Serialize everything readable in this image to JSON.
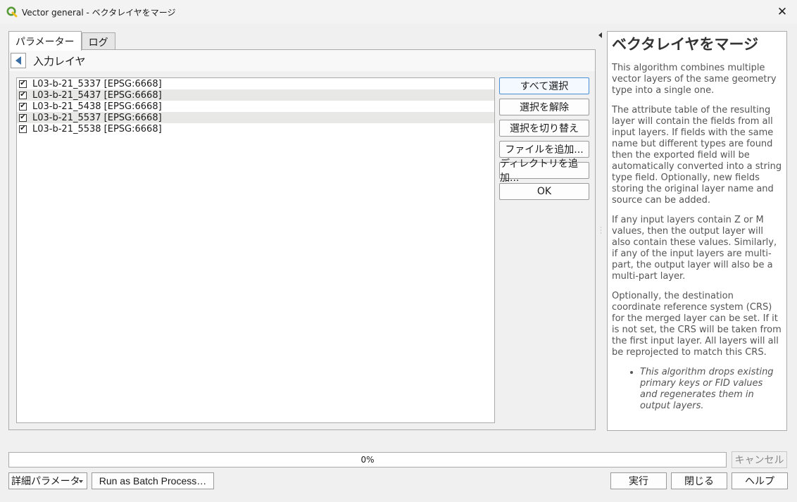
{
  "window": {
    "title": "Vector general - ベクタレイヤをマージ"
  },
  "tabs": [
    {
      "label": "パラメーター",
      "active": true
    },
    {
      "label": "ログ",
      "active": false
    }
  ],
  "panel": {
    "header_title": "入力レイヤ",
    "layers": [
      {
        "label": "L03-b-21_5337 [EPSG:6668]",
        "checked": true
      },
      {
        "label": "L03-b-21_5437 [EPSG:6668]",
        "checked": true
      },
      {
        "label": "L03-b-21_5438 [EPSG:6668]",
        "checked": true
      },
      {
        "label": "L03-b-21_5537 [EPSG:6668]",
        "checked": true
      },
      {
        "label": "L03-b-21_5538 [EPSG:6668]",
        "checked": true
      }
    ],
    "buttons": {
      "select_all": "すべて選択",
      "deselect": "選択を解除",
      "toggle": "選択を切り替え",
      "add_file": "ファイルを追加...",
      "add_directory": "ディレクトリを追加...",
      "ok": "OK"
    }
  },
  "help": {
    "title": "ベクタレイヤをマージ",
    "p1": "This algorithm combines multiple vector layers of the same geometry type into a single one.",
    "p2": "The attribute table of the resulting layer will contain the fields from all input layers. If fields with the same name but different types are found then the exported field will be automatically converted into a string type field. Optionally, new fields storing the original layer name and source can be added.",
    "p3": "If any input layers contain Z or M values, then the output layer will also contain these values. Similarly, if any of the input layers are multi-part, the output layer will also be a multi-part layer.",
    "p4": "Optionally, the destination coordinate reference system (CRS) for the merged layer can be set. If it is not set, the CRS will be taken from the first input layer. All layers will all be reprojected to match this CRS.",
    "bullet": "This algorithm drops existing primary keys or FID values and regenerates them in output layers."
  },
  "bottom": {
    "progress_text": "0%",
    "progress_value": 0,
    "cancel": "キャンセル",
    "advanced": "詳細パラメータ",
    "batch": "Run as Batch Process…",
    "run": "実行",
    "close": "閉じる",
    "help": "ヘルプ"
  },
  "colors": {
    "accent": "#4a90d9",
    "qgis_green": "#5a9a3a",
    "qgis_yellow": "#f0c020"
  }
}
